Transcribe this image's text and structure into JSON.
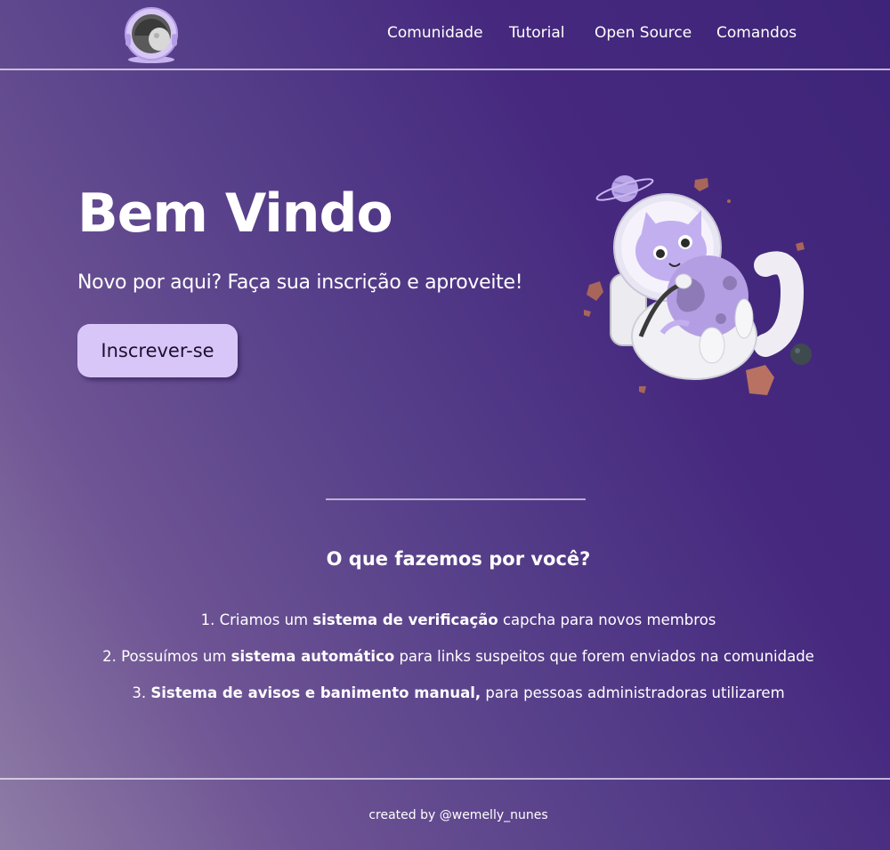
{
  "header": {
    "logo": "astronaut-helmet-logo",
    "nav": [
      {
        "label": "Comunidade"
      },
      {
        "label": "Tutorial"
      },
      {
        "label": "Open Source"
      },
      {
        "label": "Comandos"
      }
    ]
  },
  "hero": {
    "title": "Bem Vindo",
    "subtitle": "Novo por aqui? Faça sua inscrição e aproveite!",
    "cta_label": "Inscrever-se",
    "illustration": "astronaut-cat-with-moon"
  },
  "features": {
    "title": "O que fazemos por você?",
    "items": [
      {
        "number": "1.",
        "before": "Criamos um ",
        "bold": "sistema de verificação",
        "after": " capcha para novos membros"
      },
      {
        "number": "2.",
        "before": "Possuímos um ",
        "bold": "sistema automático",
        "after": " para links suspeitos que forem enviados na comunidade"
      },
      {
        "number": "3.",
        "before": "",
        "bold": "Sistema de avisos e banimento manual,",
        "after": " para pessoas administradoras utilizarem"
      }
    ]
  },
  "footer": {
    "credit": "created by @wemelly_nunes"
  },
  "colors": {
    "accent_button": "#d9c6f8",
    "background_dark": "#3e2478",
    "background_light": "#8f7ca6"
  }
}
